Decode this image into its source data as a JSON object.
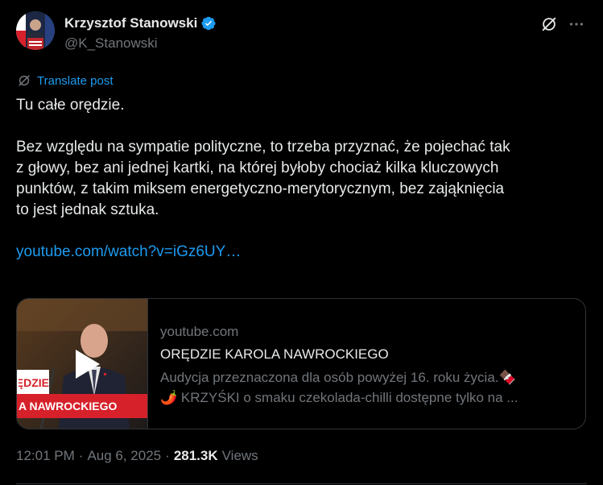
{
  "author": {
    "name": "Krzysztof Stanowski",
    "handle": "@K_Stanowski",
    "verified": true
  },
  "translate_label": "Translate post",
  "post": {
    "line1": "Tu całe orędzie.",
    "para2_lines": [
      "Bez względu na sympatie polityczne, to trzeba przyznać, że pojechać tak",
      "z głowy, bez ani jednej kartki, na której byłoby chociaż kilka kluczowych",
      "punktów, z takim miksem energetyczno-merytorycznym, bez zająknięcia",
      "to jest jednak sztuka."
    ],
    "link": "youtube.com/watch?v=iGz6UY…"
  },
  "card": {
    "domain": "youtube.com",
    "title": "ORĘDZIE KAROLA NAWROCKIEGO",
    "desc_line1": "Audycja przeznaczona dla osób powyżej 16. roku życia.🍫",
    "desc_line2": "🌶️ KRZYŚKI o smaku czekolada-chilli dostępne tylko na ...",
    "thumb_caption_top": "RĘDZIE",
    "thumb_caption_bottom": "A NAWROCKIEGO"
  },
  "meta": {
    "time": "12:01 PM",
    "sep1": "·",
    "date": "Aug 6, 2025",
    "sep2": "·",
    "views_count": "281.3K",
    "views_label": "Views"
  },
  "icons": {
    "verified": "verified-badge-icon",
    "grok": "grok-icon",
    "more": "more-icon",
    "translate": "translate-icon",
    "play": "play-icon"
  },
  "colors": {
    "background": "#000000",
    "text": "#e7e9ea",
    "muted": "#71767b",
    "accent": "#1d9bf0",
    "border": "#2f3336",
    "thumb_banner": "#d6202a"
  }
}
